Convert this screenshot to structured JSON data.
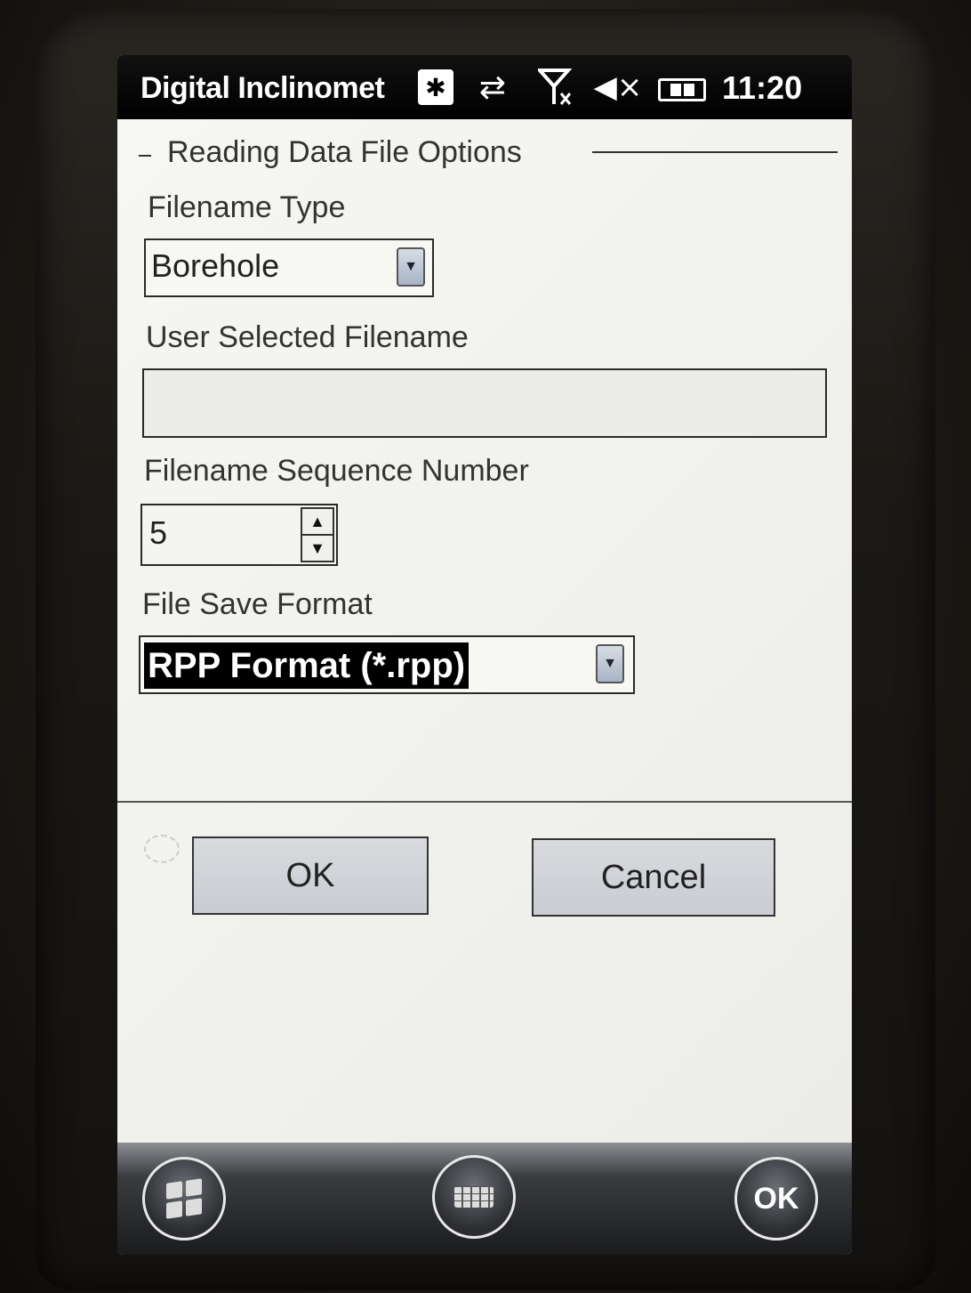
{
  "status_bar": {
    "app_title": "Digital Inclinomet",
    "bluetooth_icon": "bluetooth-icon",
    "sync_icon": "sync-arrows-icon",
    "signal_icon": "no-signal-icon",
    "volume_icon": "volume-muted-icon",
    "battery_icon": "battery-icon",
    "clock": "11:20"
  },
  "dialog": {
    "group_title": "Reading Data File Options",
    "filename_type": {
      "label": "Filename Type",
      "value": "Borehole"
    },
    "user_filename": {
      "label": "User Selected Filename",
      "value": ""
    },
    "sequence_number": {
      "label": "Filename Sequence Number",
      "value": "5"
    },
    "save_format": {
      "label": "File Save Format",
      "value": "RPP Format (*.rpp)"
    },
    "ok_label": "OK",
    "cancel_label": "Cancel"
  },
  "soft_keys": {
    "start_icon": "windows-start-icon",
    "keyboard_icon": "keyboard-icon",
    "ok_label": "OK"
  },
  "colors": {
    "title_bar": "#000000",
    "selection_highlight": "#000000",
    "button_face": "#d0d3d8"
  }
}
